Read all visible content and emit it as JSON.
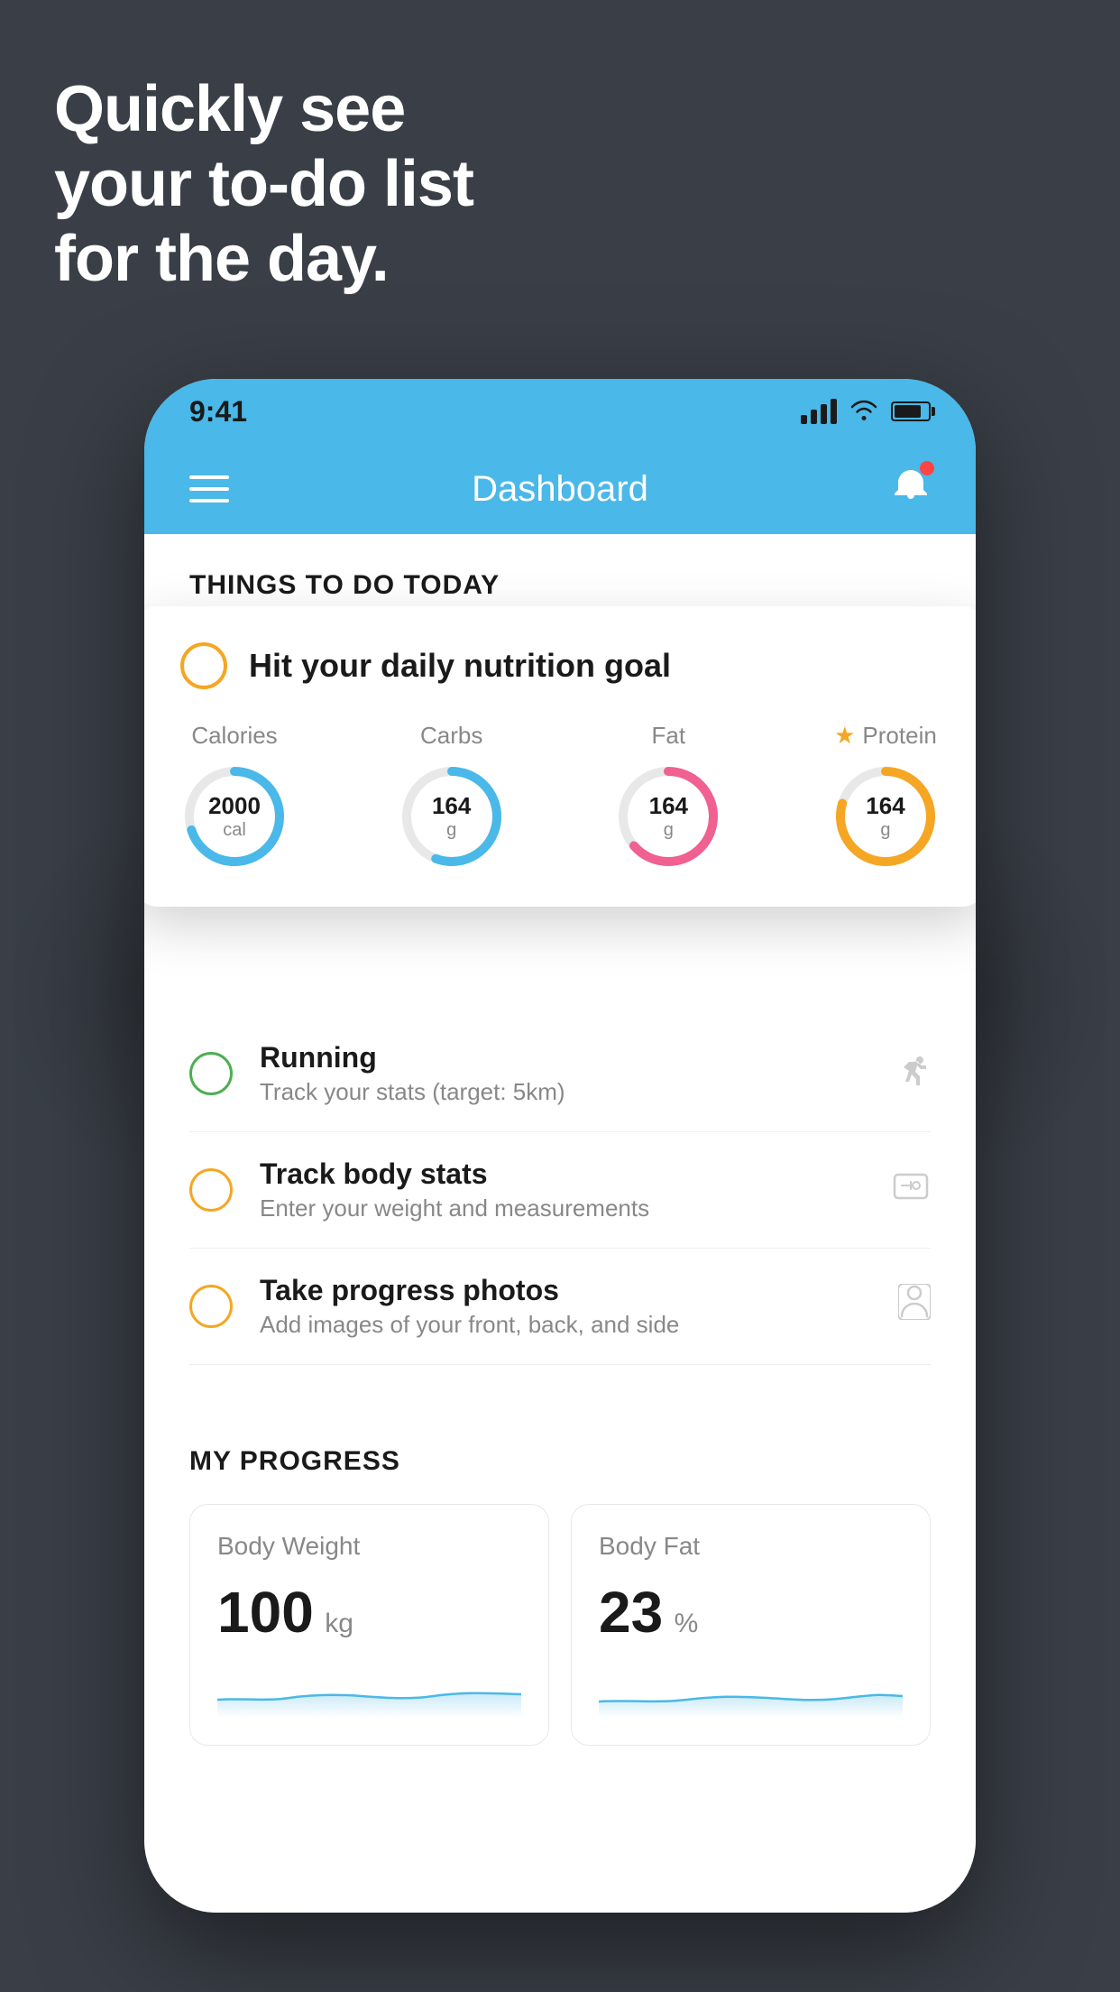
{
  "hero": {
    "line1": "Quickly see",
    "line2": "your to-do list",
    "line3": "for the day."
  },
  "status_bar": {
    "time": "9:41"
  },
  "header": {
    "title": "Dashboard"
  },
  "things_today": {
    "section_label": "THINGS TO DO TODAY"
  },
  "nutrition_card": {
    "title": "Hit your daily nutrition goal",
    "items": [
      {
        "label": "Calories",
        "value": "2000",
        "unit": "cal",
        "color": "#4ab8e8",
        "percent": 70
      },
      {
        "label": "Carbs",
        "value": "164",
        "unit": "g",
        "color": "#4ab8e8",
        "percent": 55
      },
      {
        "label": "Fat",
        "value": "164",
        "unit": "g",
        "color": "#f06090",
        "percent": 65
      },
      {
        "label": "Protein",
        "value": "164",
        "unit": "g",
        "color": "#f5a623",
        "percent": 80,
        "starred": true
      }
    ]
  },
  "list_items": [
    {
      "title": "Running",
      "subtitle": "Track your stats (target: 5km)",
      "circle_color": "green",
      "icon": "👟"
    },
    {
      "title": "Track body stats",
      "subtitle": "Enter your weight and measurements",
      "circle_color": "yellow",
      "icon": "⚖️"
    },
    {
      "title": "Take progress photos",
      "subtitle": "Add images of your front, back, and side",
      "circle_color": "yellow",
      "icon": "👤"
    }
  ],
  "progress": {
    "section_label": "MY PROGRESS",
    "cards": [
      {
        "title": "Body Weight",
        "value": "100",
        "unit": "kg"
      },
      {
        "title": "Body Fat",
        "value": "23",
        "unit": "%"
      }
    ]
  }
}
